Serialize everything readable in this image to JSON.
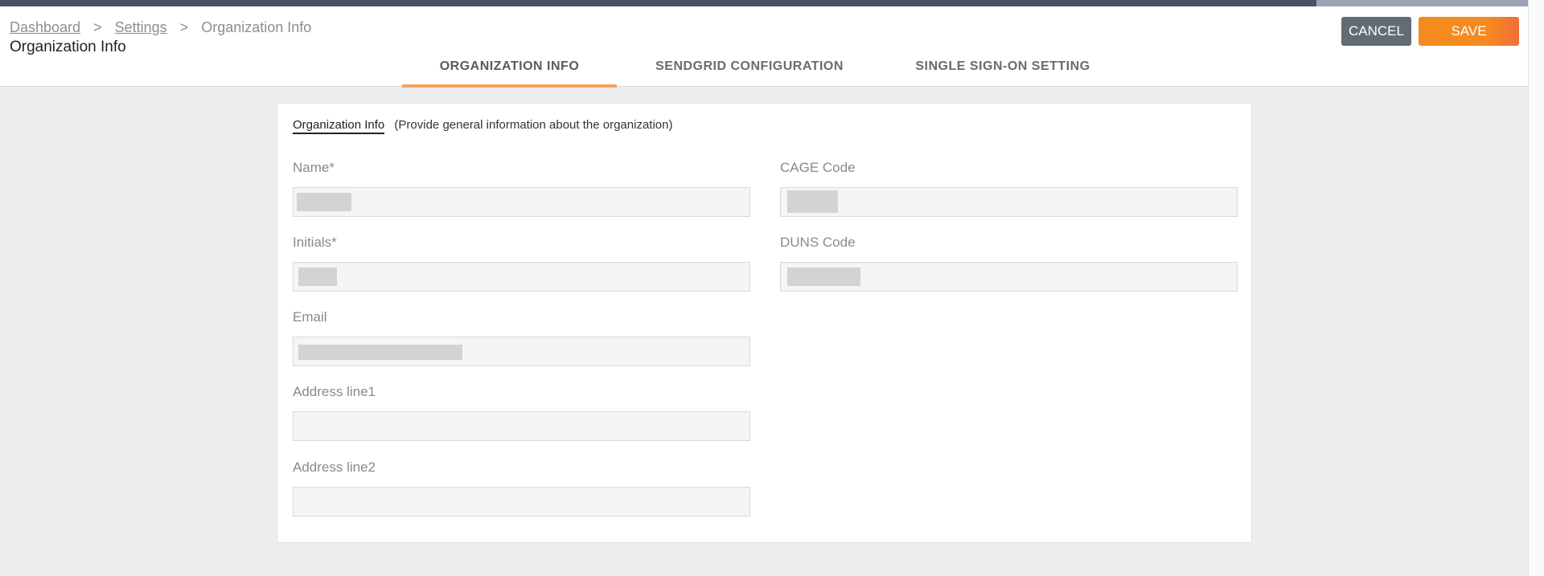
{
  "breadcrumb": {
    "items": [
      "Dashboard",
      "Settings",
      "Organization Info"
    ],
    "separator": ">"
  },
  "page_title": "Organization Info",
  "actions": {
    "cancel_label": "CANCEL",
    "save_label": "SAVE"
  },
  "tabs": [
    {
      "label": "ORGANIZATION INFO",
      "active": true
    },
    {
      "label": "SENDGRID CONFIGURATION",
      "active": false
    },
    {
      "label": "SINGLE SIGN-ON SETTING",
      "active": false
    }
  ],
  "section": {
    "title": "Organization Info",
    "description": "(Provide general information about the organization)"
  },
  "fields": {
    "name": {
      "label": "Name*",
      "value": ""
    },
    "initials": {
      "label": "Initials*",
      "value": ""
    },
    "email": {
      "label": "Email",
      "value": ""
    },
    "address1": {
      "label": "Address line1",
      "value": ""
    },
    "address2": {
      "label": "Address line2",
      "value": ""
    },
    "cage": {
      "label": "CAGE Code",
      "value": ""
    },
    "duns": {
      "label": "DUNS Code",
      "value": ""
    }
  },
  "colors": {
    "accent": "#f58a1f",
    "cancel": "#636b75",
    "topbar": "#4a5264"
  }
}
